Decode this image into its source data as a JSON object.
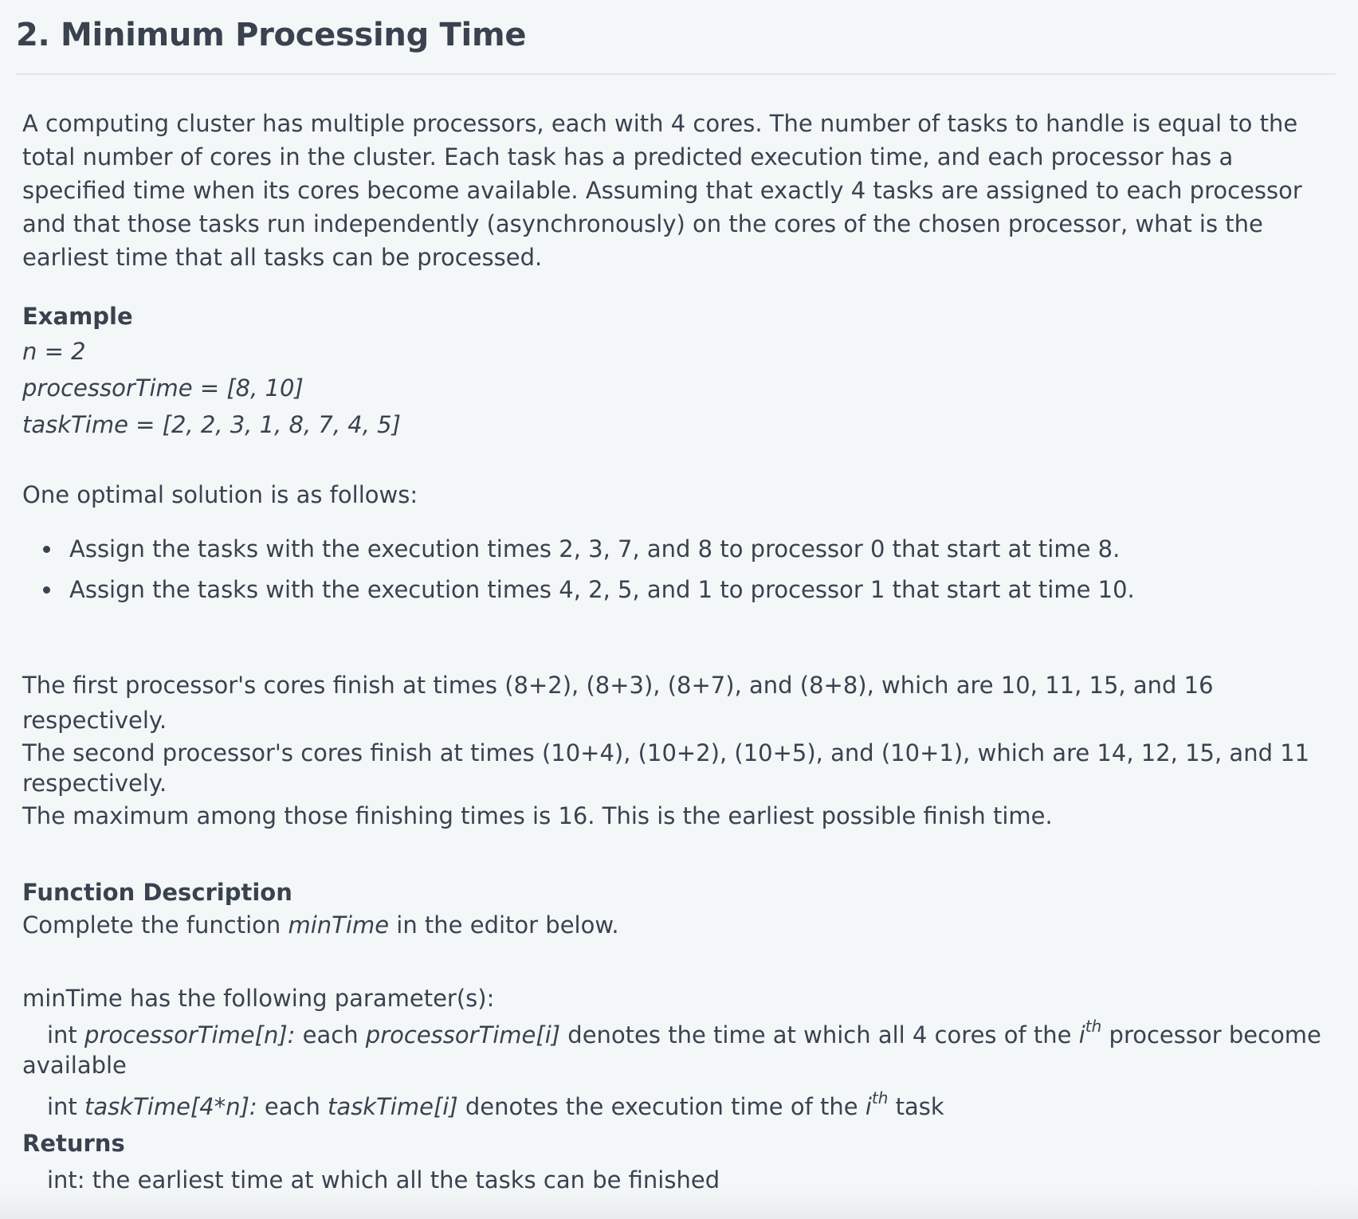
{
  "title": "2. Minimum Processing Time",
  "intro": "A computing cluster has multiple processors, each with 4 cores. The number of tasks to handle is equal to the total number of cores in the cluster. Each task has a predicted execution time, and each processor has a specified time when its cores become available. Assuming that exactly 4 tasks are assigned to each processor and that those tasks run independently (asynchronously) on the cores of the chosen processor, what is the earliest time that all tasks can be processed.",
  "example": {
    "heading": "Example",
    "n_line": "n = 2",
    "processor_line": "processorTime = [8, 10]",
    "task_line": "taskTime = [2, 2, 3, 1, 8, 7, 4, 5]"
  },
  "solution": {
    "intro": "One optimal solution is as follows:",
    "bullets": [
      "Assign the tasks with the execution times 2, 3, 7, and 8 to processor 0 that start at time 8.",
      "Assign the tasks with the execution times 4, 2, 5, and 1 to processor 1 that start at time 10."
    ]
  },
  "explanation": {
    "line1": "The first processor's cores finish at times (8+2), (8+3), (8+7), and (8+8), which are 10, 11, 15, and 16 respectively.",
    "line2a": "The second processor's cores finish at times (10+4), (10+2), (10+5), and (10+1), which are 14, 12, 15, and 11",
    "line2b": "respectively.",
    "line3": "The maximum among those finishing times is 16. This is the earliest possible finish time."
  },
  "function_description": {
    "heading": "Function Description",
    "text_before": "Complete the function ",
    "function_name": "minTime",
    "text_after": " in the editor below."
  },
  "parameters": {
    "intro": "minTime has the following parameter(s):",
    "p1_type": "int ",
    "p1_name": "processorTime[n]:",
    "p1_each": "  each ",
    "p1_ref": "processorTime[i]",
    "p1_desc": " denotes the time at which all 4 cores of the ",
    "p1_i": "i",
    "p1_sup": "th",
    "p1_tail": " processor become",
    "p1_wrap": "available",
    "p2_type": "int ",
    "p2_name": "taskTime[4*n]:",
    "p2_each": " each ",
    "p2_ref": "taskTime[i]",
    "p2_desc": " denotes the execution time of the ",
    "p2_i": "i",
    "p2_sup": "th",
    "p2_tail": " task"
  },
  "returns": {
    "heading": "Returns",
    "text": "int: the earliest time at which all the tasks can be finished"
  }
}
